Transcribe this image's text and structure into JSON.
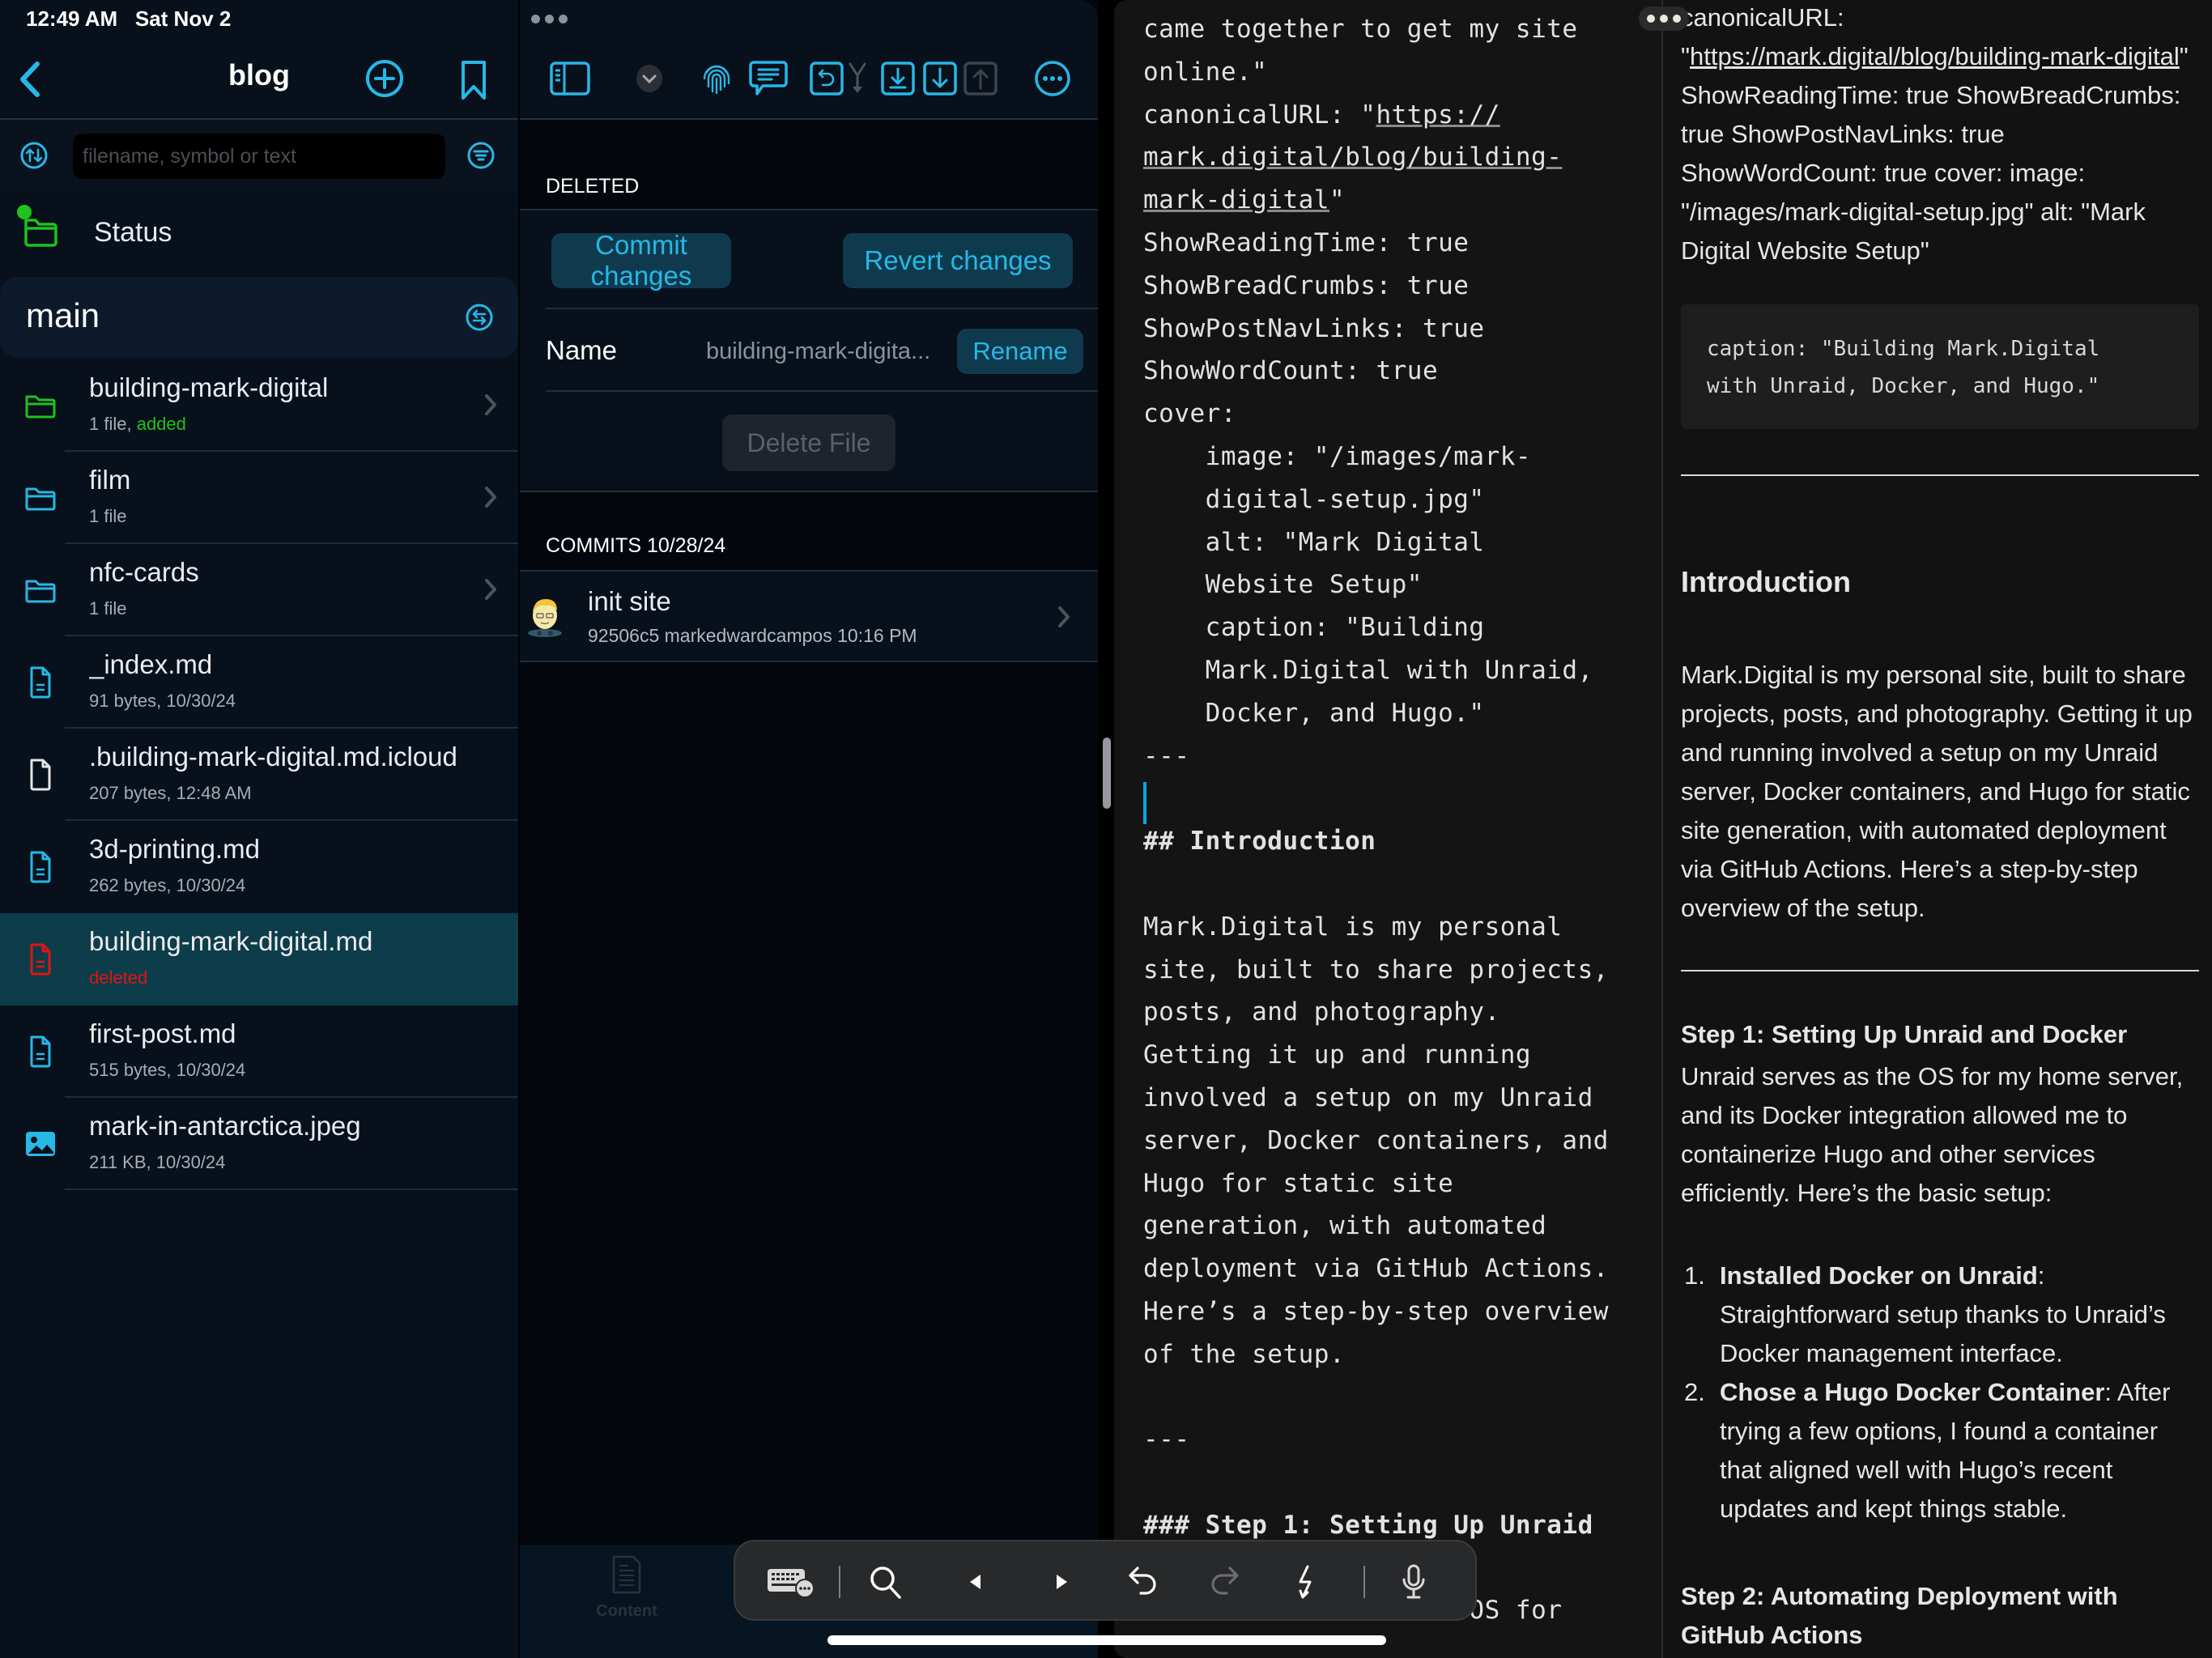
{
  "status_bar": {
    "time": "12:49 AM",
    "date": "Sat Nov 2"
  },
  "sidebar": {
    "title": "blog",
    "search": {
      "value": "",
      "placeholder": "filename, symbol or text"
    },
    "status_label": "Status",
    "branch": "main",
    "files": [
      {
        "name": "building-mark-digital",
        "meta": "1 file, ",
        "status": "added",
        "type": "folder",
        "color": "#1ec31e",
        "chevron": true,
        "selected": false
      },
      {
        "name": "film",
        "meta": "1 file",
        "status": "",
        "type": "folder",
        "color": "#27b8e6",
        "chevron": true,
        "selected": false
      },
      {
        "name": "nfc-cards",
        "meta": "1 file",
        "status": "",
        "type": "folder",
        "color": "#27b8e6",
        "chevron": true,
        "selected": false
      },
      {
        "name": "_index.md",
        "meta": "91 bytes, 10/30/24",
        "status": "",
        "type": "doc",
        "color": "#27b8e6",
        "chevron": false,
        "selected": false
      },
      {
        "name": ".building-mark-digital.md.icloud",
        "meta": "207 bytes, 12:48 AM",
        "status": "",
        "type": "blank",
        "color": "#e6e6e6",
        "chevron": false,
        "selected": false
      },
      {
        "name": "3d-printing.md",
        "meta": "262 bytes, 10/30/24",
        "status": "",
        "type": "doc",
        "color": "#27b8e6",
        "chevron": false,
        "selected": false
      },
      {
        "name": "building-mark-digital.md",
        "meta": "",
        "status": "deleted",
        "type": "doc",
        "color": "#e01515",
        "chevron": false,
        "selected": true
      },
      {
        "name": "first-post.md",
        "meta": "515 bytes, 10/30/24",
        "status": "",
        "type": "doc",
        "color": "#27b8e6",
        "chevron": false,
        "selected": false
      },
      {
        "name": "mark-in-antarctica.jpeg",
        "meta": "211 KB, 10/30/24",
        "status": "",
        "type": "image",
        "color": "#27b8e6",
        "chevron": false,
        "selected": false
      }
    ]
  },
  "detail": {
    "section_status": "DELETED",
    "commit_button": "Commit changes",
    "revert_button": "Revert changes",
    "name_label": "Name",
    "name_value": "building-mark-digita...",
    "rename_button": "Rename",
    "delete_button": "Delete File",
    "commits_header": "COMMITS 10/28/24",
    "commits": [
      {
        "title": "init site",
        "hash": "92506c5",
        "author": "markedwardcampos",
        "time": "10:16 PM"
      }
    ],
    "tab_label": "Content"
  },
  "editor": {
    "lines": [
      {
        "text": "came together to get my site",
        "indent": 0
      },
      {
        "text": "online.\"",
        "indent": 0
      },
      {
        "text": "canonicalURL: \"",
        "link": "https://",
        "indent": 0
      },
      {
        "link": "mark.digital/blog/building-",
        "indent": 0
      },
      {
        "link": "mark-digital",
        "after": "\"",
        "indent": 0
      },
      {
        "text": "ShowReadingTime: true",
        "indent": 0
      },
      {
        "text": "ShowBreadCrumbs: true",
        "indent": 0
      },
      {
        "text": "ShowPostNavLinks: true",
        "indent": 0
      },
      {
        "text": "ShowWordCount: true",
        "indent": 0
      },
      {
        "text": "cover:",
        "indent": 0
      },
      {
        "text": "image: \"/images/mark-",
        "indent": 1
      },
      {
        "text": "digital-setup.jpg\"",
        "indent": 1
      },
      {
        "text": "alt: \"Mark Digital",
        "indent": 1
      },
      {
        "text": "Website Setup\"",
        "indent": 1
      },
      {
        "text": "caption: \"Building",
        "indent": 1
      },
      {
        "text": "Mark.Digital with Unraid,",
        "indent": 1
      },
      {
        "text": "Docker, and Hugo.\"",
        "indent": 1
      },
      {
        "text": "---",
        "indent": 0
      },
      {
        "text": "",
        "indent": 0
      },
      {
        "text": "## Introduction",
        "indent": 0,
        "heading": true
      },
      {
        "text": "",
        "indent": 0
      },
      {
        "text": "Mark.Digital is my personal",
        "indent": 0
      },
      {
        "text": "site, built to share projects,",
        "indent": 0
      },
      {
        "text": "posts, and photography.",
        "indent": 0
      },
      {
        "text": "Getting it up and running",
        "indent": 0
      },
      {
        "text": "involved a setup on my Unraid",
        "indent": 0
      },
      {
        "text": "server, Docker containers, and",
        "indent": 0
      },
      {
        "text": "Hugo for static site",
        "indent": 0
      },
      {
        "text": "generation, with automated",
        "indent": 0
      },
      {
        "text": "deployment via GitHub Actions.",
        "indent": 0
      },
      {
        "text": "Here’s a step-by-step overview",
        "indent": 0
      },
      {
        "text": "of the setup.",
        "indent": 0
      },
      {
        "text": "",
        "indent": 0
      },
      {
        "text": "---",
        "indent": 0
      },
      {
        "text": "",
        "indent": 0
      },
      {
        "text": "### Step 1: Setting Up Unraid",
        "indent": 0,
        "heading": true
      },
      {
        "text": "",
        "indent": 0
      },
      {
        "text": "Unraid serves as the OS for",
        "indent": 0
      }
    ]
  },
  "preview": {
    "front_matter_prefix": "canonicalURL: \"",
    "front_matter_link": "https://mark.digital/blog/building-mark-digital",
    "front_matter_rest": "\" ShowReadingTime: true ShowBreadCrumbs: true ShowPostNavLinks: true ShowWordCount: true cover: image: \"/images/mark-digital-setup.jpg\" alt: \"Mark Digital Website Setup\"",
    "code_block": "caption: \"Building Mark.Digital\nwith Unraid, Docker, and Hugo.\"",
    "intro_heading": "Introduction",
    "intro_paragraph": "Mark.Digital is my personal site, built to share projects, posts, and photography. Getting it up and running involved a setup on my Unraid server, Docker containers, and Hugo for static site generation, with automated deployment via GitHub Actions. Here’s a step-by-step overview of the setup.",
    "step1_heading": "Step 1: Setting Up Unraid and Docker",
    "step1_paragraph": "Unraid serves as the OS for my home server, and its Docker integration allowed me to containerize Hugo and other services efficiently. Here’s the basic setup:",
    "step1_list": [
      {
        "num": "1.",
        "bold": "Installed Docker on Unraid",
        "rest": ": Straightforward setup thanks to Unraid’s Docker management interface."
      },
      {
        "num": "2.",
        "bold": "Chose a Hugo Docker Container",
        "rest": ": After trying a few options, I found a container that aligned well with Hugo’s recent updates and kept things stable."
      }
    ],
    "step2_heading": "Step 2: Automating Deployment with GitHub Actions"
  },
  "colors": {
    "accent": "#27b8e6",
    "added": "#1ec31e",
    "deleted": "#e01515",
    "selected_row": "#0d3d4a"
  }
}
